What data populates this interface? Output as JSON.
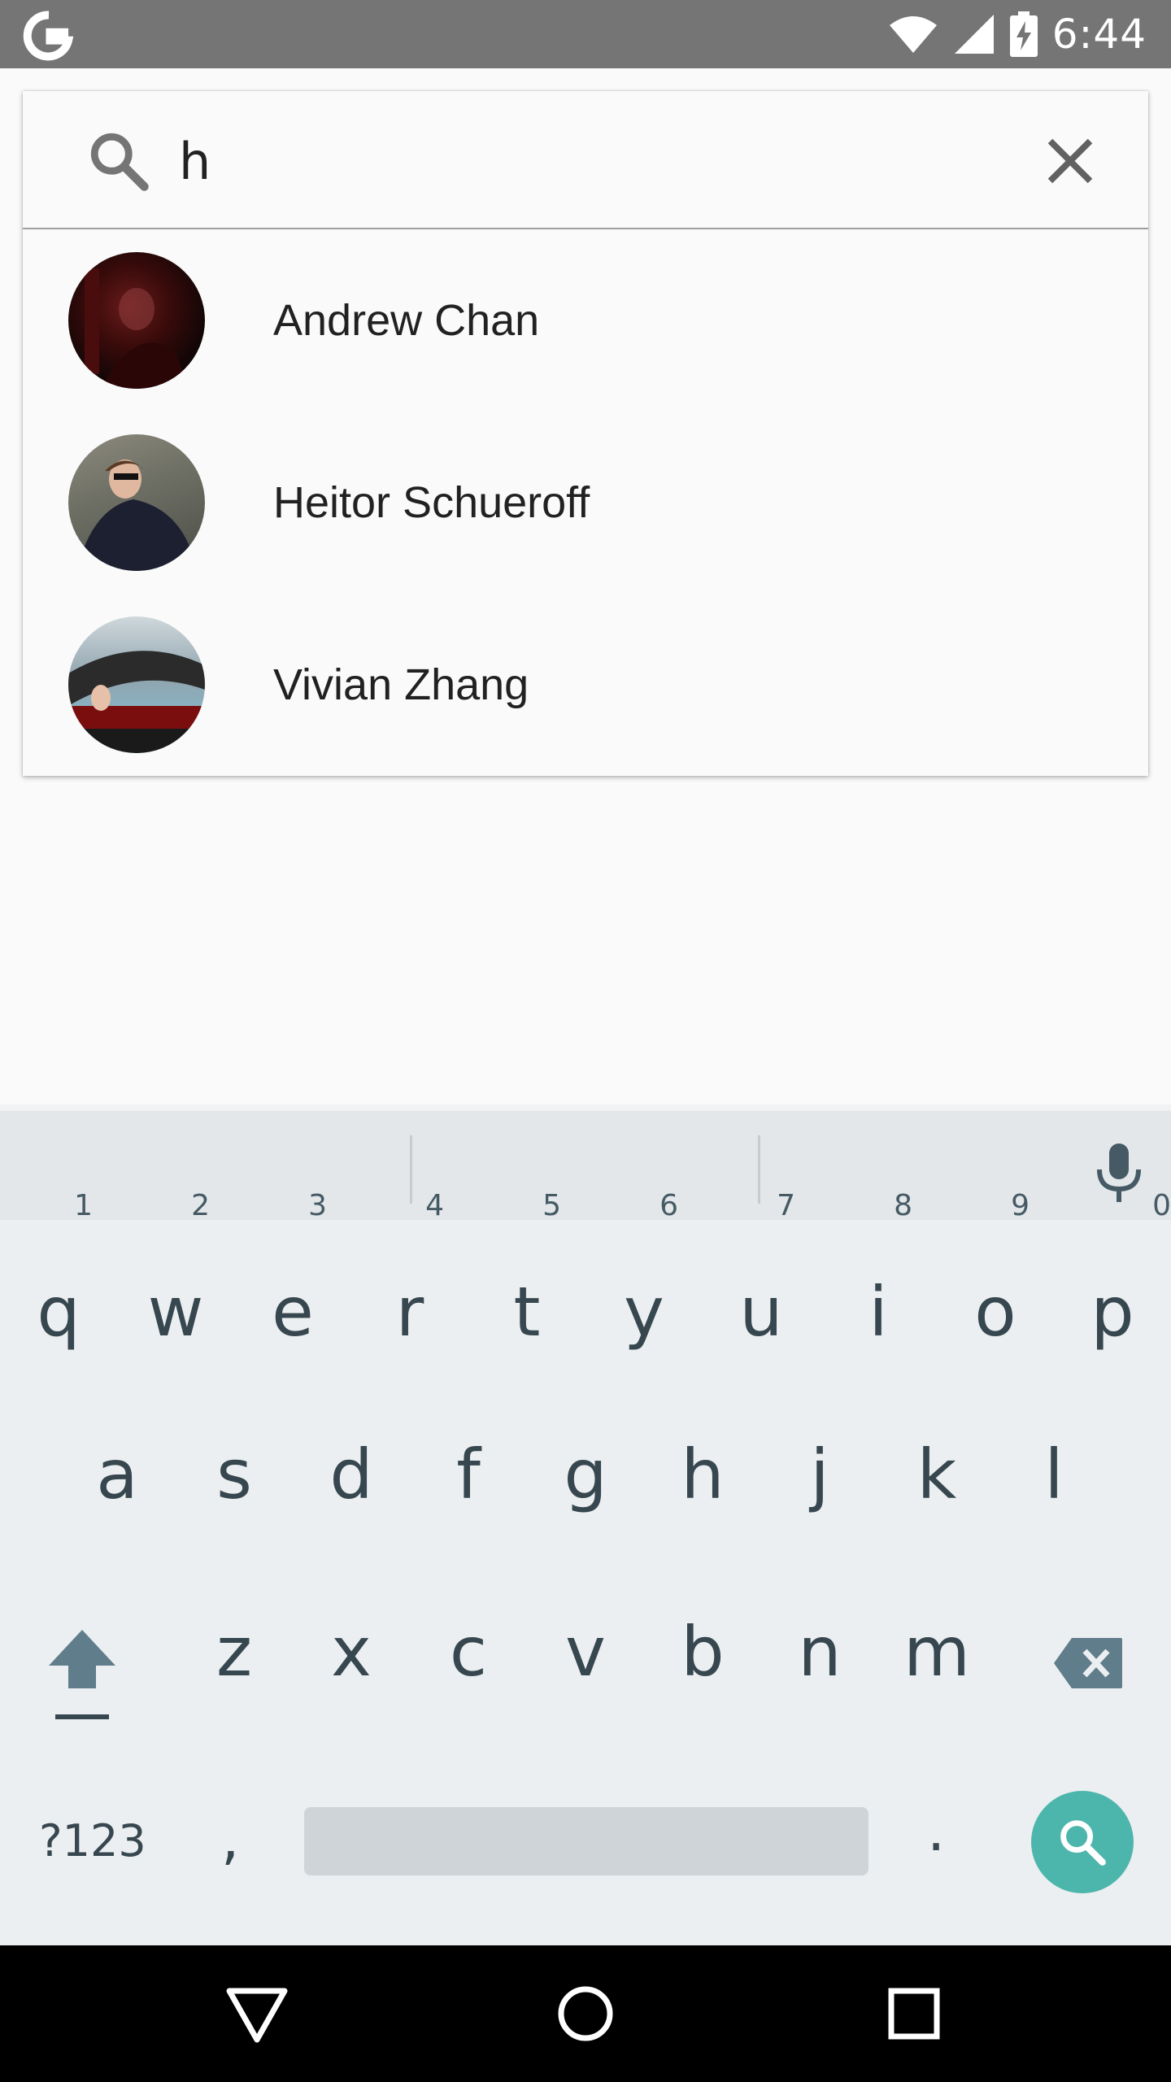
{
  "status_bar": {
    "time": "6:44",
    "icons": [
      "google-g-icon",
      "wifi-icon",
      "cell-signal-icon",
      "battery-charging-icon"
    ]
  },
  "search": {
    "query": "h",
    "placeholder": ""
  },
  "results": [
    {
      "name": "Andrew Chan"
    },
    {
      "name": "Heitor Schueroff"
    },
    {
      "name": "Vivian Zhang"
    }
  ],
  "keyboard": {
    "row1": [
      {
        "key": "q",
        "hint": "1"
      },
      {
        "key": "w",
        "hint": "2"
      },
      {
        "key": "e",
        "hint": "3"
      },
      {
        "key": "r",
        "hint": "4"
      },
      {
        "key": "t",
        "hint": "5"
      },
      {
        "key": "y",
        "hint": "6"
      },
      {
        "key": "u",
        "hint": "7"
      },
      {
        "key": "i",
        "hint": "8"
      },
      {
        "key": "o",
        "hint": "9"
      },
      {
        "key": "p",
        "hint": "0"
      }
    ],
    "row2": [
      "a",
      "s",
      "d",
      "f",
      "g",
      "h",
      "j",
      "k",
      "l"
    ],
    "row3": [
      "z",
      "x",
      "c",
      "v",
      "b",
      "n",
      "m"
    ],
    "symbols_label": "?123",
    "comma": ",",
    "period": "."
  },
  "colors": {
    "status_bar": "#757575",
    "accent": "#4db6ac",
    "key_text": "#37474f",
    "keyboard_bg": "#eceff1"
  }
}
